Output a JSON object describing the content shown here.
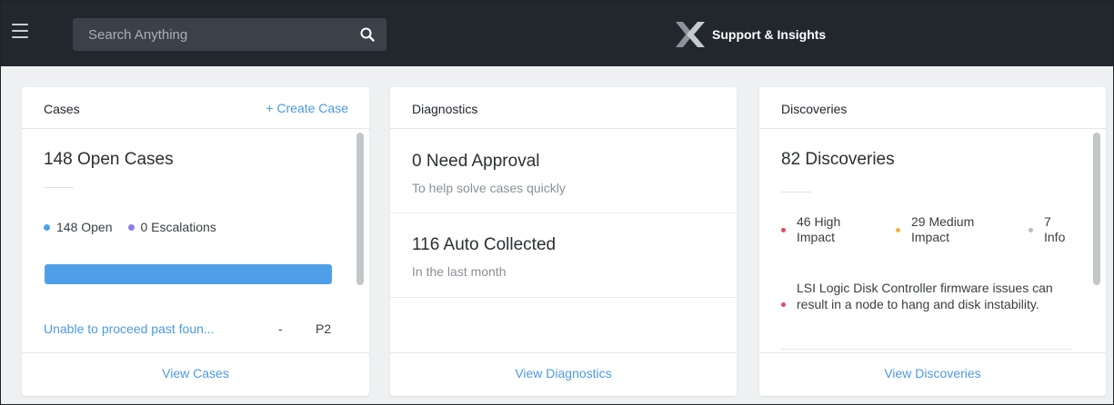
{
  "header": {
    "search_placeholder": "Search Anything",
    "brand_title": "Support & Insights"
  },
  "colors": {
    "topbar": "#22272e",
    "accent": "#4a9ae6",
    "open": "#4e9fe8",
    "escalations": "#8f7ce6",
    "high_impact": "#e24b5a",
    "medium_impact": "#f2b23c",
    "info": "#b8bcc2"
  },
  "icons": {
    "menu": "hamburger-menu-icon",
    "search": "search-icon",
    "brand": "x-logo-icon"
  },
  "cases": {
    "title": "Cases",
    "create_label": "+ Create Case",
    "open_count_label": "148 Open Cases",
    "open_legend": "148 Open",
    "escalations_legend": "0 Escalations",
    "open_fraction": 1.0,
    "item": {
      "title": "Unable to proceed past foun...",
      "dash": "-",
      "priority": "P2"
    },
    "view_label": "View Cases"
  },
  "diagnostics": {
    "title": "Diagnostics",
    "need_approval": "0 Need Approval",
    "need_approval_sub": "To help solve cases quickly",
    "auto_collected": "116 Auto Collected",
    "auto_collected_sub": "In the last month",
    "view_label": "View Diagnostics"
  },
  "discoveries": {
    "title": "Discoveries",
    "count_label": "82 Discoveries",
    "high": {
      "line1": "46 High",
      "line2": "Impact"
    },
    "medium": {
      "line1": "29 Medium",
      "line2": "Impact"
    },
    "info": {
      "line1": "7",
      "line2": "Info"
    },
    "item_text": "LSI Logic Disk Controller firmware issues can result in a node to hang and disk instability.",
    "view_label": "View Discoveries"
  }
}
